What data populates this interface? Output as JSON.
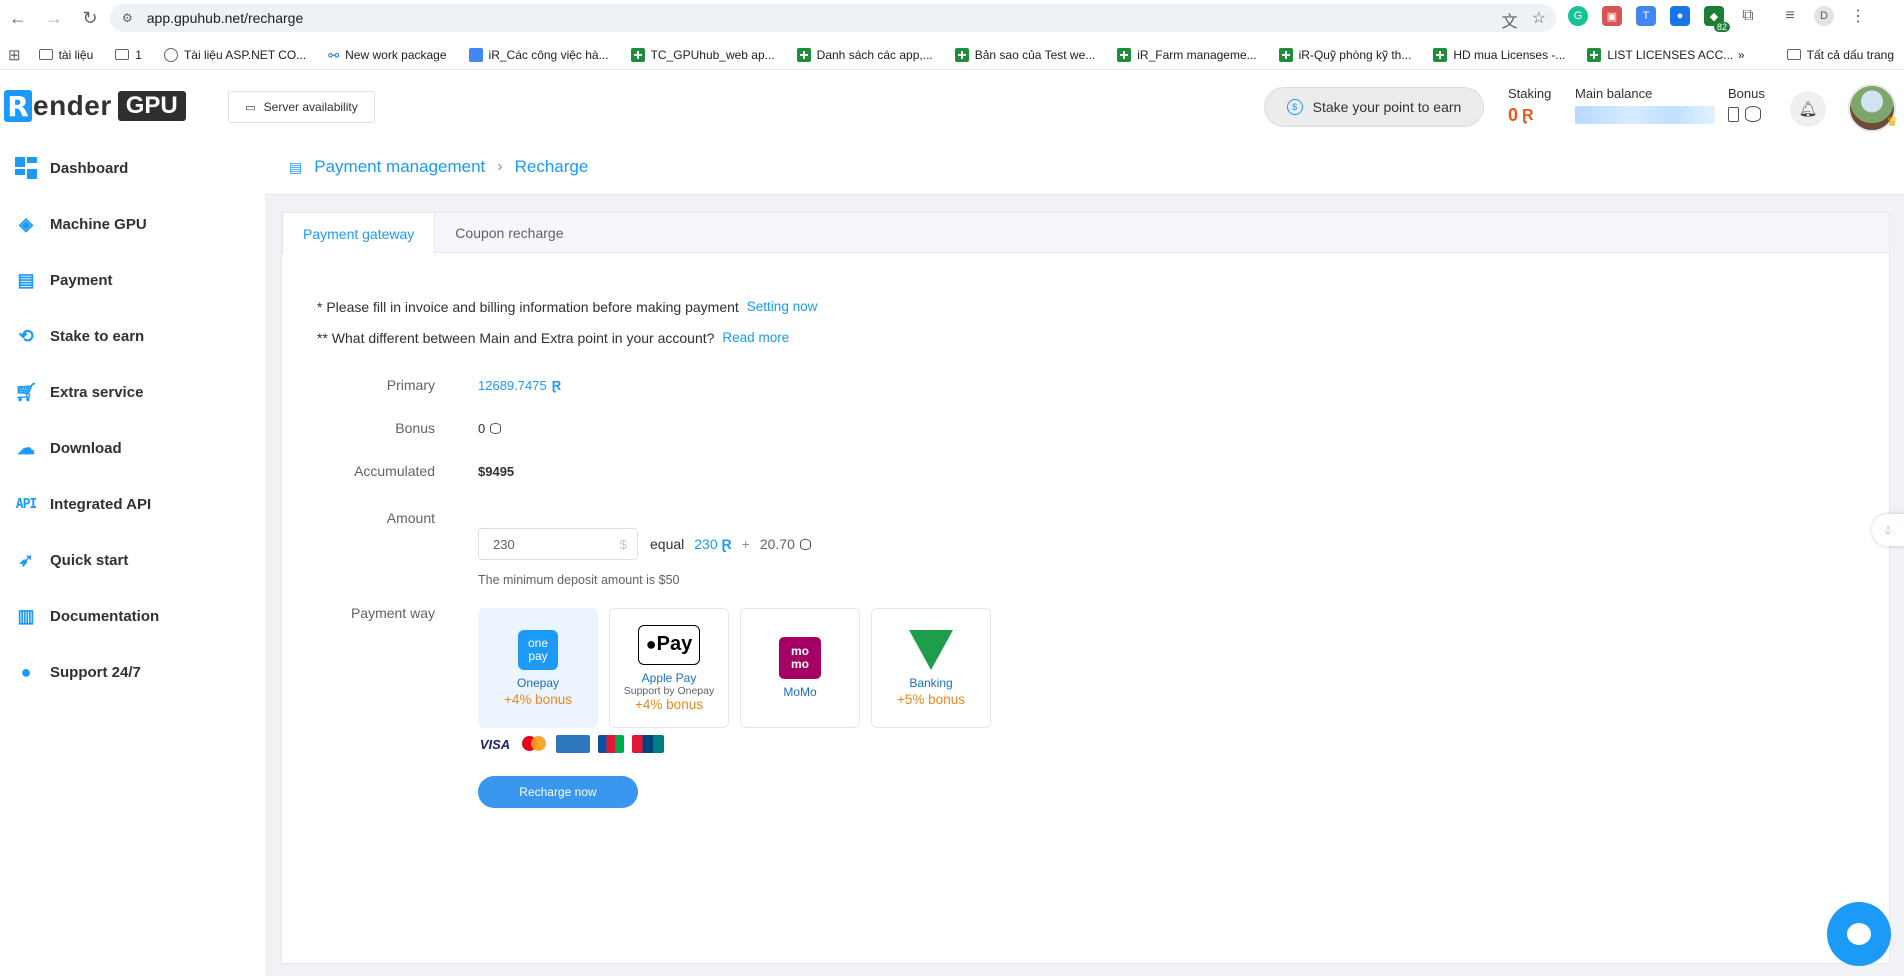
{
  "browser": {
    "url": "app.gpuhub.net/recharge",
    "bookmarks": [
      {
        "label": "tài liệu",
        "icon": "folder-icon"
      },
      {
        "label": "1",
        "icon": "folder-icon"
      },
      {
        "label": "Tài liệu ASP.NET CO...",
        "icon": "globe-icon"
      },
      {
        "label": "New work package",
        "icon": "link-icon"
      },
      {
        "label": "iR_Các công việc hà...",
        "icon": "doc-icon"
      },
      {
        "label": "TC_GPUhub_web ap...",
        "icon": "sheet-icon"
      },
      {
        "label": "Danh sách các app,...",
        "icon": "sheet-icon"
      },
      {
        "label": "Bản sao của Test we...",
        "icon": "sheet-icon"
      },
      {
        "label": "iR_Farm manageme...",
        "icon": "sheet-icon"
      },
      {
        "label": "iR-Quỹ phòng kỹ th...",
        "icon": "sheet-icon"
      },
      {
        "label": "HD mua Licenses -...",
        "icon": "sheet-icon"
      },
      {
        "label": "LIST LICENSES ACC...",
        "icon": "sheet-icon"
      }
    ],
    "all_bookmarks": "Tất cả dấu trang",
    "ext_badge": "82",
    "profile_initial": "D"
  },
  "header": {
    "logo_ir": "R",
    "logo_ender": "ender",
    "logo_gpu": "GPU",
    "server_availability": "Server availability",
    "stake_button": "Stake your point to earn",
    "staking_label": "Staking",
    "staking_value": "0",
    "main_balance_label": "Main balance",
    "bonus_label": "Bonus"
  },
  "sidebar": {
    "items": [
      {
        "label": "Dashboard",
        "icon": "dashboard-icon"
      },
      {
        "label": "Machine GPU",
        "icon": "layers-icon"
      },
      {
        "label": "Payment",
        "icon": "wallet-icon"
      },
      {
        "label": "Stake to earn",
        "icon": "stake-icon"
      },
      {
        "label": "Extra service",
        "icon": "cart-icon"
      },
      {
        "label": "Download",
        "icon": "cloud-download-icon"
      },
      {
        "label": "Integrated API",
        "icon": "api-icon"
      },
      {
        "label": "Quick start",
        "icon": "rocket-icon"
      },
      {
        "label": "Documentation",
        "icon": "book-icon"
      },
      {
        "label": "Support 24/7",
        "icon": "chat-icon"
      }
    ],
    "api_glyph": "API"
  },
  "breadcrumb": {
    "parent": "Payment management",
    "sep": "›",
    "current": "Recharge"
  },
  "tabs": {
    "active": "Payment gateway",
    "other": "Coupon recharge"
  },
  "notes": {
    "line1": "* Please fill in invoice and billing information before making payment",
    "line1_link": "Setting now",
    "line2": "** What different between Main and Extra point in your account?",
    "line2_link": "Read more"
  },
  "form": {
    "primary_label": "Primary",
    "primary_value": "12689.7475",
    "bonus_label": "Bonus",
    "bonus_value": "0",
    "accumulated_label": "Accumulated",
    "accumulated_value": "$9495",
    "amount_label": "Amount",
    "amount_value": "230",
    "amount_unit": "$",
    "equal_text": "equal",
    "equal_points": "230",
    "plus": "+",
    "equal_bonus": "20.70",
    "min_note": "The minimum deposit amount is $50",
    "payment_way_label": "Payment way"
  },
  "payment_methods": [
    {
      "name": "Onepay",
      "bonus": "+4% bonus",
      "selected": true,
      "logo_line1": "one",
      "logo_line2": "pay"
    },
    {
      "name": "Apple Pay",
      "sub": "Support by Onepay",
      "bonus": "+4% bonus",
      "logo": "Pay"
    },
    {
      "name": "MoMo",
      "logo_line1": "mo",
      "logo_line2": "mo"
    },
    {
      "name": "Banking",
      "bonus": "+5% bonus"
    }
  ],
  "card_brands": [
    "VISA",
    "mastercard",
    "AMEX",
    "JCB",
    "UnionPay"
  ],
  "recharge_button": "Recharge now",
  "colors": {
    "accent": "#1b9af7",
    "bonus": "#e8891c",
    "staking": "#e8581c",
    "momo": "#a50064",
    "banking": "#1e9e4a"
  }
}
